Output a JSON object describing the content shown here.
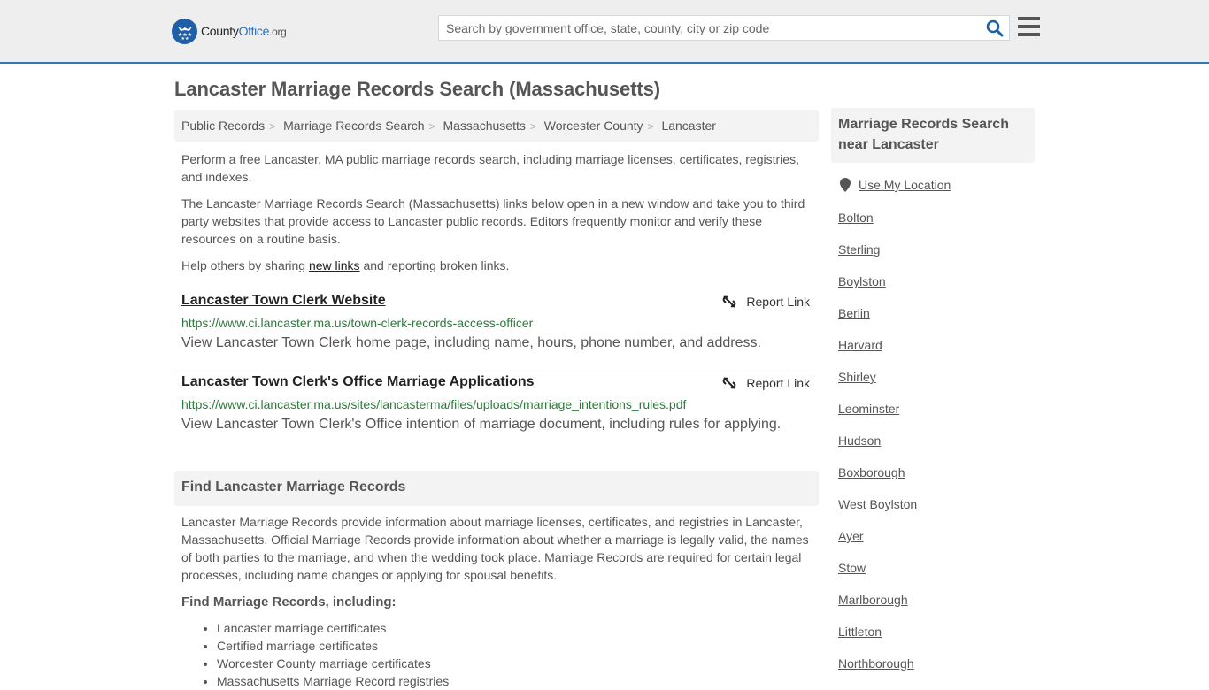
{
  "header": {
    "logo": {
      "county": "County",
      "office": "Office",
      "tld": ".org"
    },
    "search": {
      "placeholder": "Search by government office, state, county, city or zip code",
      "value": ""
    },
    "brand_color": "#1f5fa8",
    "accent_border": "#3079b4"
  },
  "page": {
    "title": "Lancaster Marriage Records Search (Massachusetts)"
  },
  "breadcrumb": [
    {
      "label": "Public Records"
    },
    {
      "label": "Marriage Records Search"
    },
    {
      "label": "Massachusetts"
    },
    {
      "label": "Worcester County"
    },
    {
      "label": "Lancaster"
    }
  ],
  "intro": {
    "p1": "Perform a free Lancaster, MA public marriage records search, including marriage licenses, certificates, registries, and indexes.",
    "p2": "The Lancaster Marriage Records Search (Massachusetts) links below open in a new window and take you to third party websites that provide access to Lancaster public records. Editors frequently monitor and verify these resources on a routine basis.",
    "p3_before": "Help others by sharing ",
    "p3_link": "new links",
    "p3_after": " and reporting broken links."
  },
  "results": [
    {
      "title": "Lancaster Town Clerk Website",
      "url": "https://www.ci.lancaster.ma.us/town-clerk-records-access-officer",
      "description": "View Lancaster Town Clerk home page, including name, hours, phone number, and address.",
      "report_label": "Report Link"
    },
    {
      "title": "Lancaster Town Clerk's Office Marriage Applications",
      "url": "https://www.ci.lancaster.ma.us/sites/lancasterma/files/uploads/marriage_intentions_rules.pdf",
      "description": "View Lancaster Town Clerk's Office intention of marriage document, including rules for applying.",
      "report_label": "Report Link"
    }
  ],
  "find_section": {
    "heading": "Find Lancaster Marriage Records",
    "body": "Lancaster Marriage Records provide information about marriage licenses, certificates, and registries in Lancaster, Massachusetts. Official Marriage Records provide information about whether a marriage is legally valid, the names of both parties to the marriage, and when the wedding took place. Marriage Records are required for certain legal processes, including name changes or applying for spousal benefits.",
    "subheading": "Find Marriage Records, including:",
    "items": [
      "Lancaster marriage certificates",
      "Certified marriage certificates",
      "Worcester County marriage certificates",
      "Massachusetts Marriage Record registries"
    ]
  },
  "sidebar": {
    "heading": "Marriage Records Search near Lancaster",
    "use_location": "Use My Location",
    "nearby": [
      "Bolton",
      "Sterling",
      "Boylston",
      "Berlin",
      "Harvard",
      "Shirley",
      "Leominster",
      "Hudson",
      "Boxborough",
      "West Boylston",
      "Ayer",
      "Stow",
      "Marlborough",
      "Littleton",
      "Northborough"
    ]
  }
}
